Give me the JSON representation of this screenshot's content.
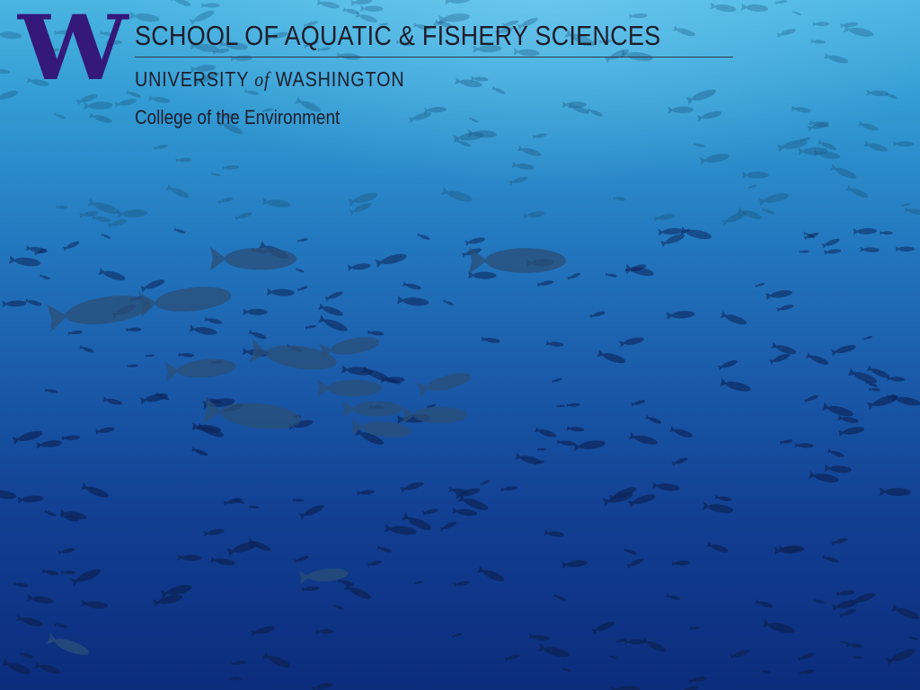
{
  "logo": {
    "letter": "W",
    "color": "#34187a"
  },
  "header": {
    "school": "SCHOOL OF AQUATIC & FISHERY SCIENCES",
    "university_pre": "UNIVERSITY",
    "university_of": "of",
    "university_post": "WASHINGTON",
    "college": "College of the Environment"
  }
}
